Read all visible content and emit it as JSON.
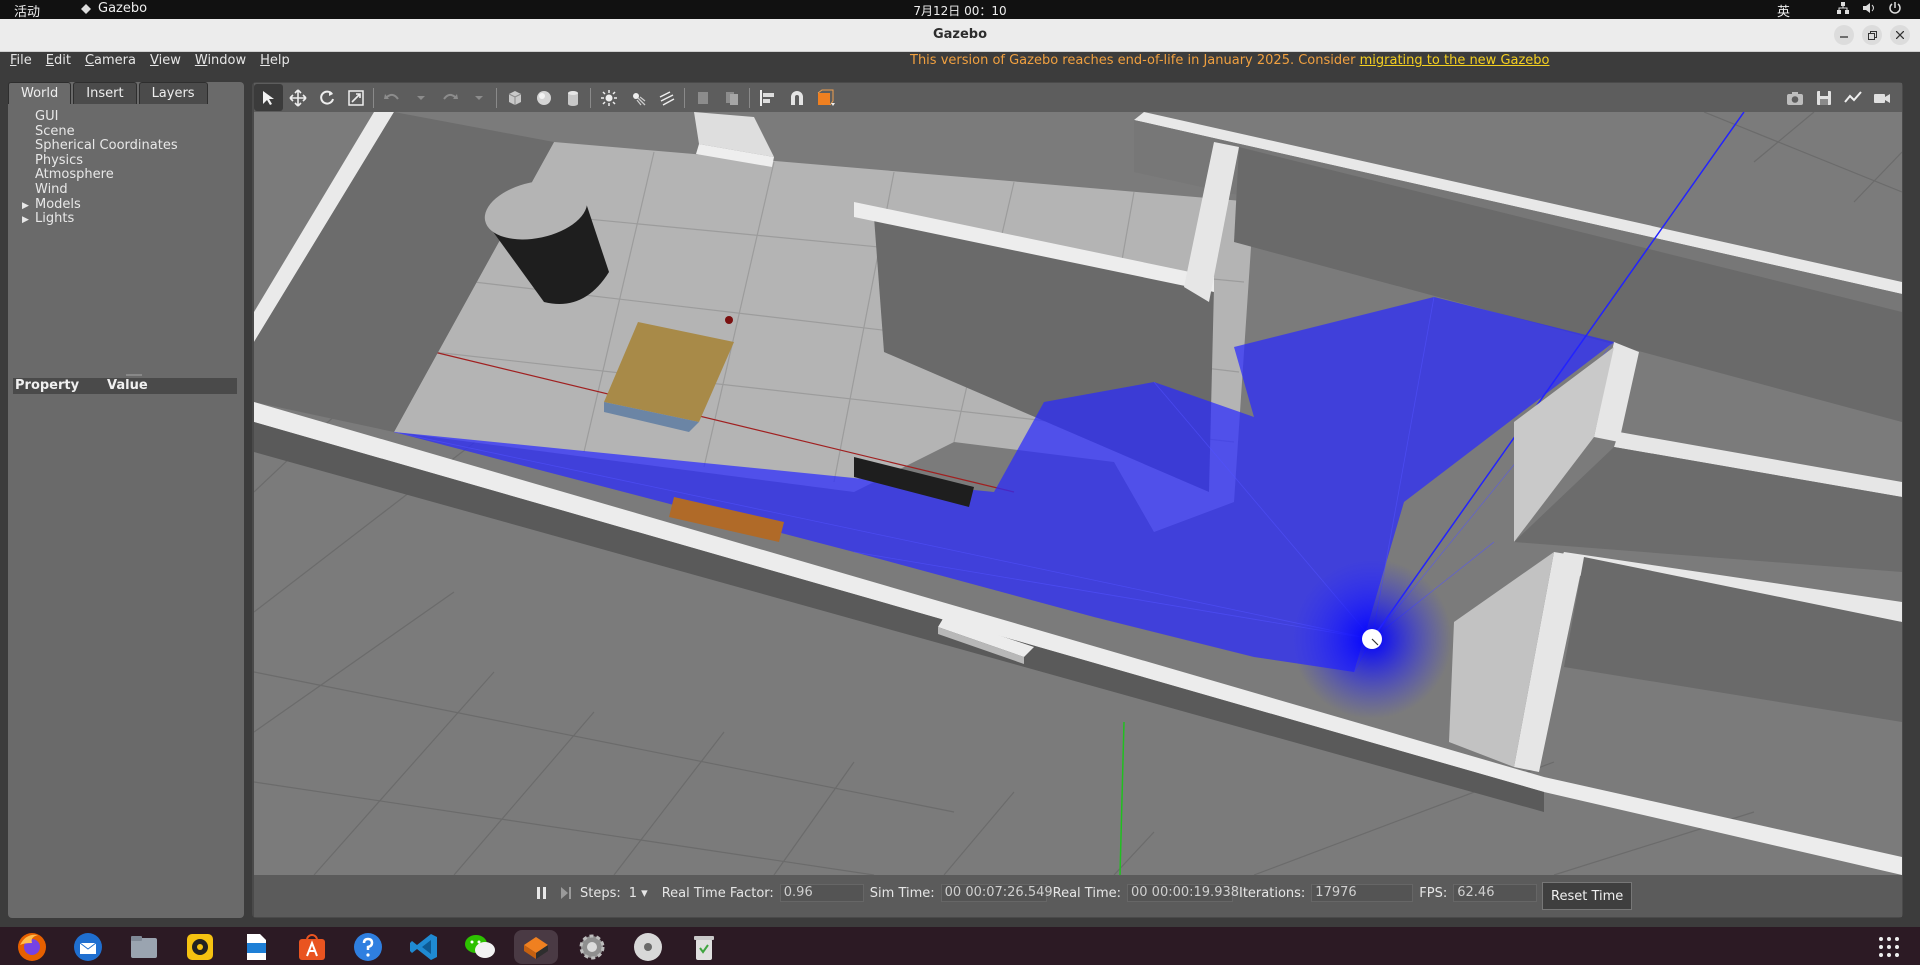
{
  "topbar": {
    "activities": "活动",
    "app_name": "Gazebo",
    "clock": "7月12日  00：10",
    "ime": "英"
  },
  "window": {
    "title": "Gazebo"
  },
  "menubar": {
    "items": [
      "File",
      "Edit",
      "Camera",
      "View",
      "Window",
      "Help"
    ],
    "eol_message": "This version of Gazebo reaches end-of-life in January 2025. Consider ",
    "eol_link": "migrating to the new Gazebo"
  },
  "left_panel": {
    "tabs": [
      "World",
      "Insert",
      "Layers"
    ],
    "tree": [
      "GUI",
      "Scene",
      "Spherical Coordinates",
      "Physics",
      "Atmosphere",
      "Wind",
      "Models",
      "Lights"
    ],
    "property_header": [
      "Property",
      "Value"
    ]
  },
  "status": {
    "steps_label": "Steps:",
    "steps_value": "1",
    "rtf_label": "Real Time Factor:",
    "rtf_value": "0.96",
    "sim_time_label": "Sim Time:",
    "sim_time_value": "00 00:07:26.549",
    "real_time_label": "Real Time:",
    "real_time_value": "00 00:00:19.938",
    "iterations_label": "Iterations:",
    "iterations_value": "17976",
    "fps_label": "FPS:",
    "fps_value": "62.46",
    "reset_label": "Reset Time"
  },
  "colors": {
    "laser": "#2a2aff",
    "accent_orange": "#f08020"
  }
}
